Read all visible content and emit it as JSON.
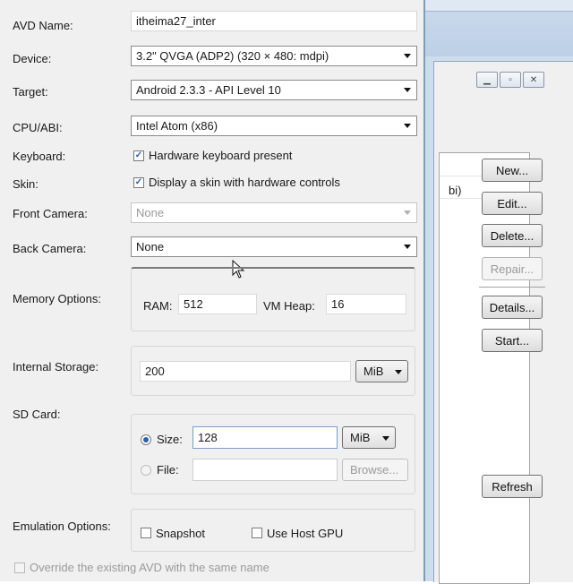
{
  "avd_name": {
    "label": "AVD Name:",
    "value": "itheima27_inter"
  },
  "device": {
    "label": "Device:",
    "value": "3.2\" QVGA (ADP2) (320 × 480: mdpi)"
  },
  "target": {
    "label": "Target:",
    "value": "Android 2.3.3 - API Level 10"
  },
  "cpu_abi": {
    "label": "CPU/ABI:",
    "value": "Intel Atom (x86)"
  },
  "keyboard": {
    "label": "Keyboard:",
    "checkbox_label": "Hardware keyboard present",
    "checked": true
  },
  "skin": {
    "label": "Skin:",
    "checkbox_label": "Display a skin with hardware controls",
    "checked": true
  },
  "front_camera": {
    "label": "Front Camera:",
    "value": "None",
    "enabled": false
  },
  "back_camera": {
    "label": "Back Camera:",
    "value": "None"
  },
  "memory": {
    "label": "Memory Options:",
    "ram_label": "RAM:",
    "ram_value": "512",
    "vm_heap_label": "VM Heap:",
    "vm_heap_value": "16"
  },
  "internal_storage": {
    "label": "Internal Storage:",
    "value": "200",
    "unit": "MiB"
  },
  "sd_card": {
    "label": "SD Card:",
    "size_label": "Size:",
    "size_value": "128",
    "size_unit": "MiB",
    "size_selected": true,
    "file_label": "File:",
    "file_value": "",
    "browse_label": "Browse..."
  },
  "emulation": {
    "label": "Emulation Options:",
    "snapshot_label": "Snapshot",
    "host_gpu_label": "Use Host GPU"
  },
  "override": {
    "label": "Override the existing AVD with the same name",
    "enabled": false
  },
  "manager": {
    "abi_fragment": "bi)",
    "buttons": {
      "new": "New...",
      "edit": "Edit...",
      "delete": "Delete...",
      "repair": "Repair...",
      "details": "Details...",
      "start": "Start...",
      "refresh": "Refresh"
    }
  },
  "icons": {
    "check": "check-icon",
    "dropdown": "chevron-down-icon",
    "cursor": "mouse-pointer-icon"
  },
  "colors": {
    "dialog_bg": "#f0f0f0",
    "window_frame": "#cfdcec",
    "accent": "#2a5fb3"
  }
}
